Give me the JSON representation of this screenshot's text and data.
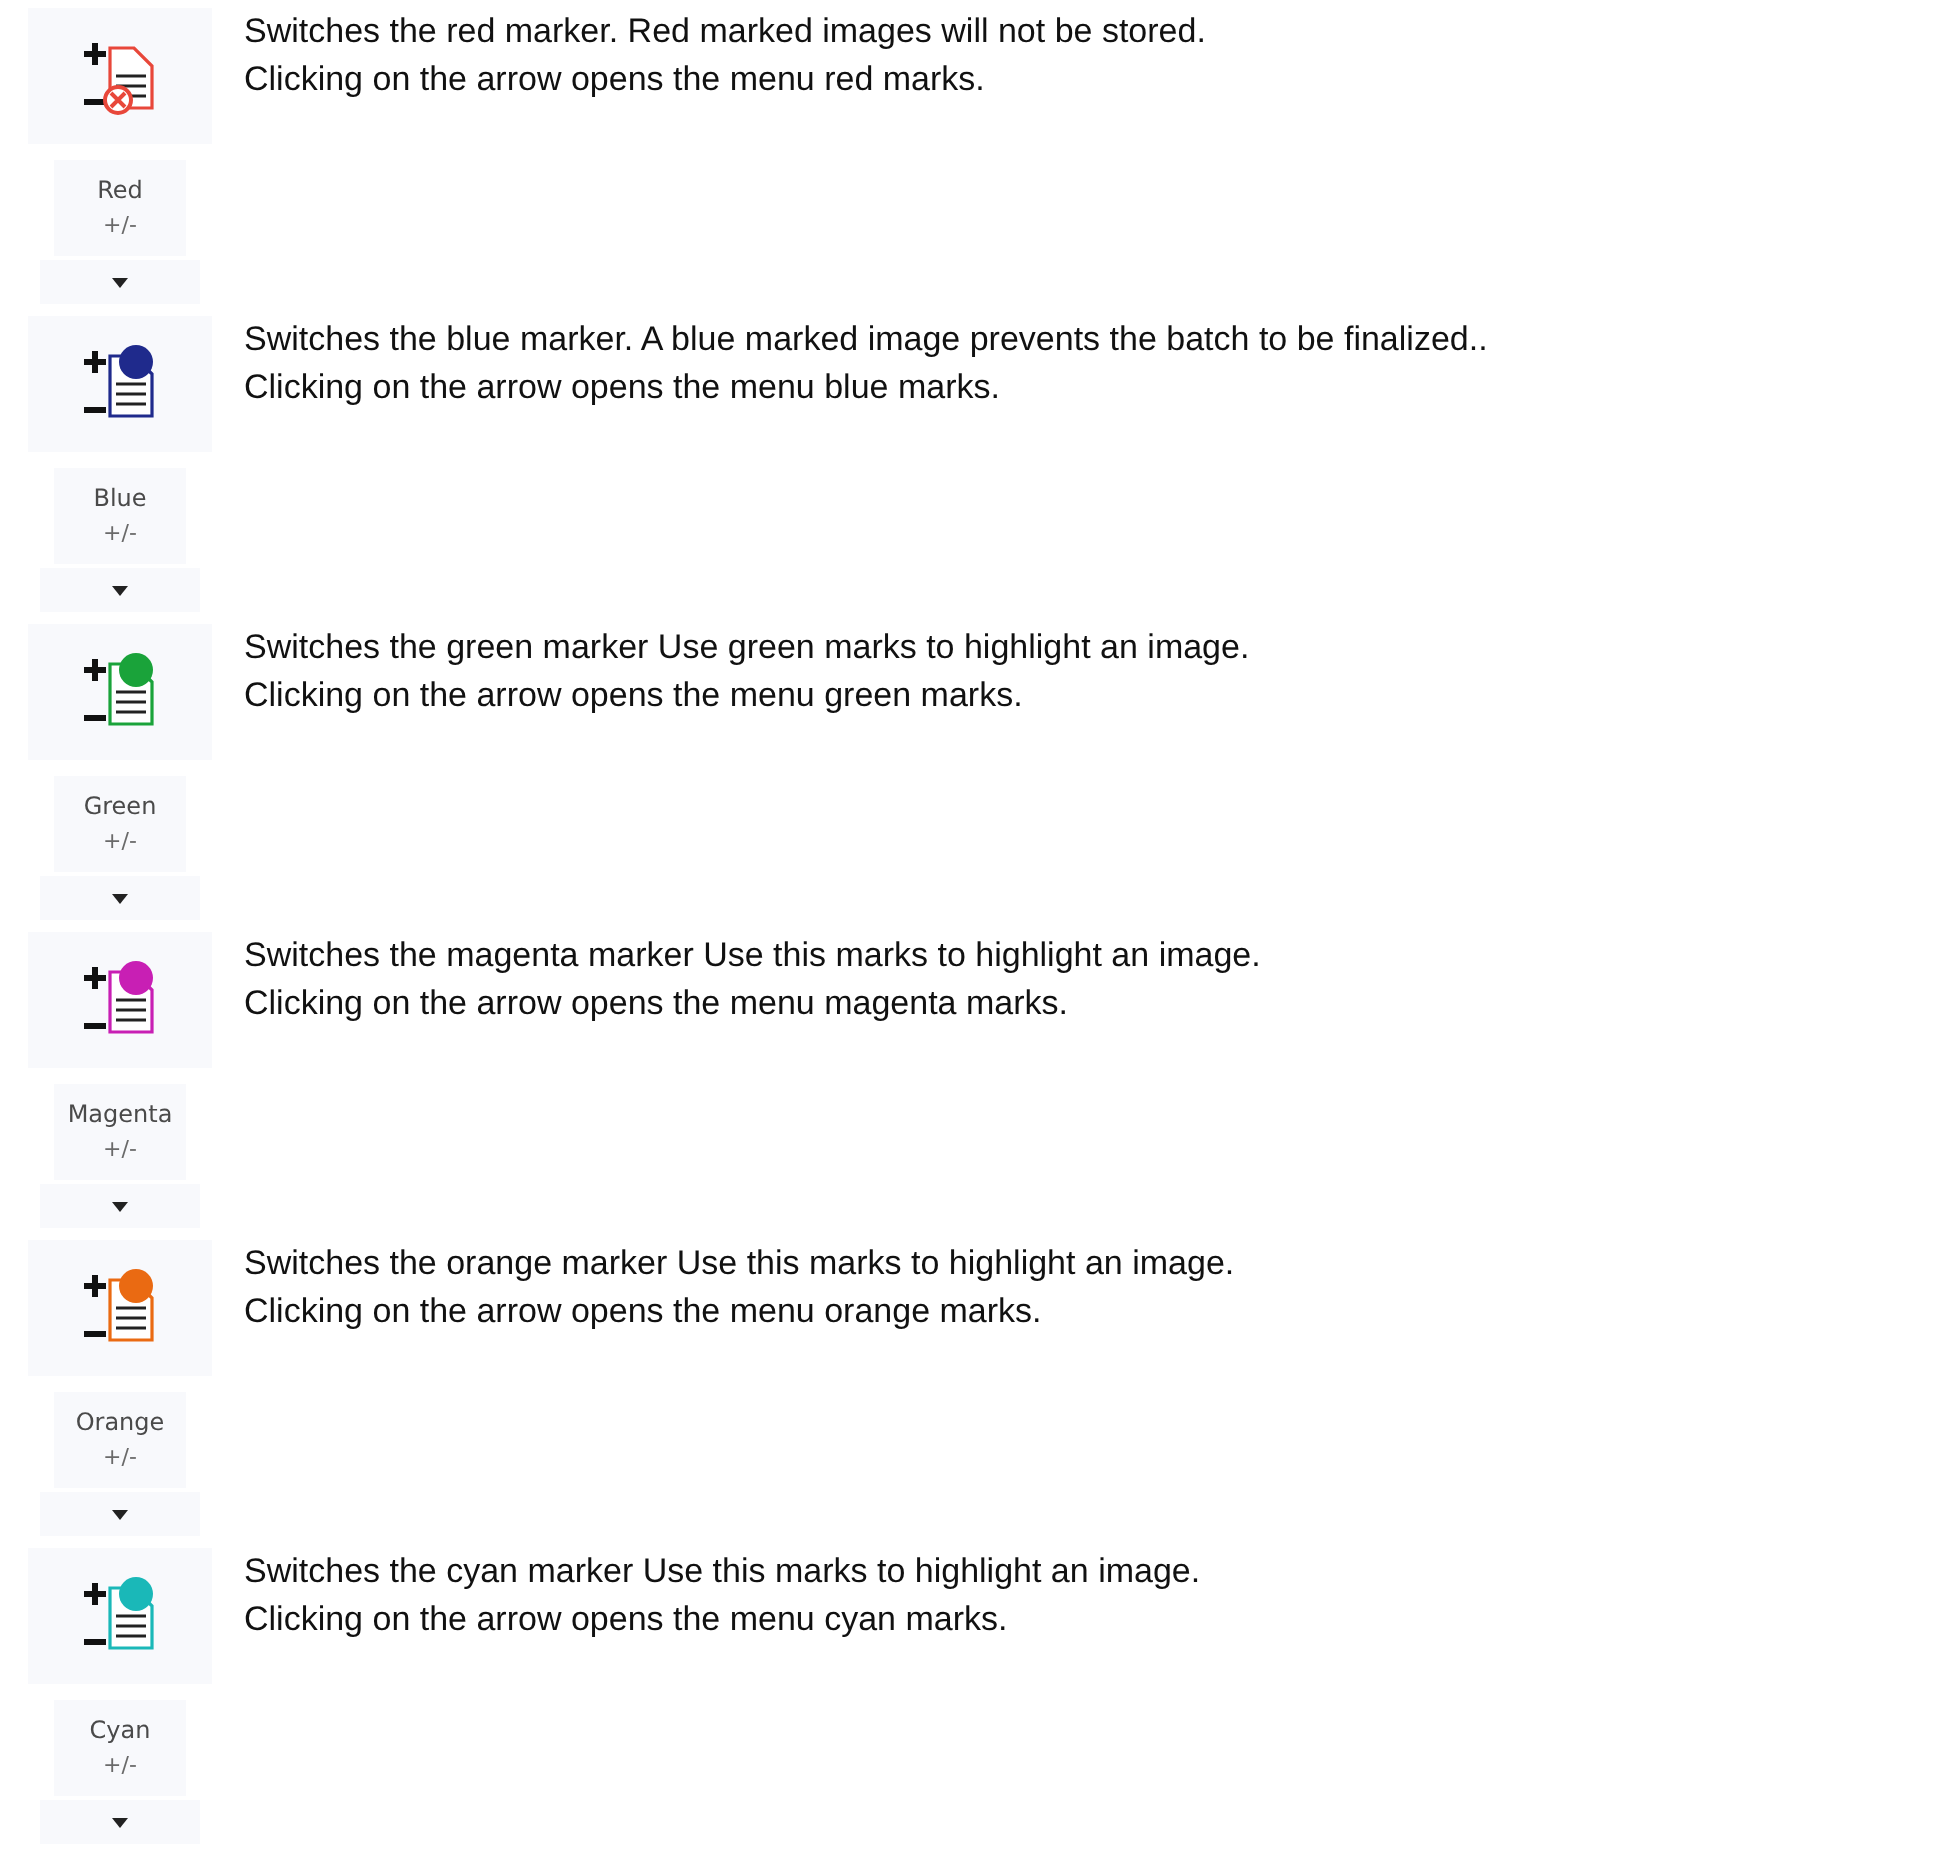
{
  "markers": [
    {
      "kind": "cross",
      "color": "#e8473a",
      "label": "Red",
      "sub": "+/-",
      "paragraphs": [
        "Switches the red marker. Red marked images will not be stored.",
        "Clicking on the arrow opens the menu red marks."
      ]
    },
    {
      "kind": "dot",
      "color": "#1f2a8c",
      "label": "Blue",
      "sub": "+/-",
      "paragraphs": [
        "Switches the blue marker. A blue marked image prevents the batch to be finalized..",
        "Clicking on the arrow opens the menu blue marks."
      ]
    },
    {
      "kind": "dot",
      "color": "#1aa33a",
      "label": "Green",
      "sub": "+/-",
      "paragraphs": [
        "Switches the green marker Use green marks to highlight an image.",
        "Clicking on the arrow opens the menu green marks."
      ]
    },
    {
      "kind": "dot",
      "color": "#c81fb4",
      "label": "Magenta",
      "sub": "+/-",
      "paragraphs": [
        "Switches the magenta marker Use this marks to highlight an image.",
        "Clicking on the arrow opens the menu magenta marks."
      ]
    },
    {
      "kind": "dot",
      "color": "#ea6a12",
      "label": "Orange",
      "sub": "+/-",
      "paragraphs": [
        "Switches the orange marker Use this marks to highlight an image.",
        "Clicking on the arrow opens the menu orange marks."
      ]
    },
    {
      "kind": "dot",
      "color": "#1ab8b8",
      "label": "Cyan",
      "sub": "+/-",
      "paragraphs": [
        "Switches the cyan marker Use this marks to highlight an image.",
        "Clicking on the arrow opens the menu cyan marks."
      ]
    }
  ]
}
